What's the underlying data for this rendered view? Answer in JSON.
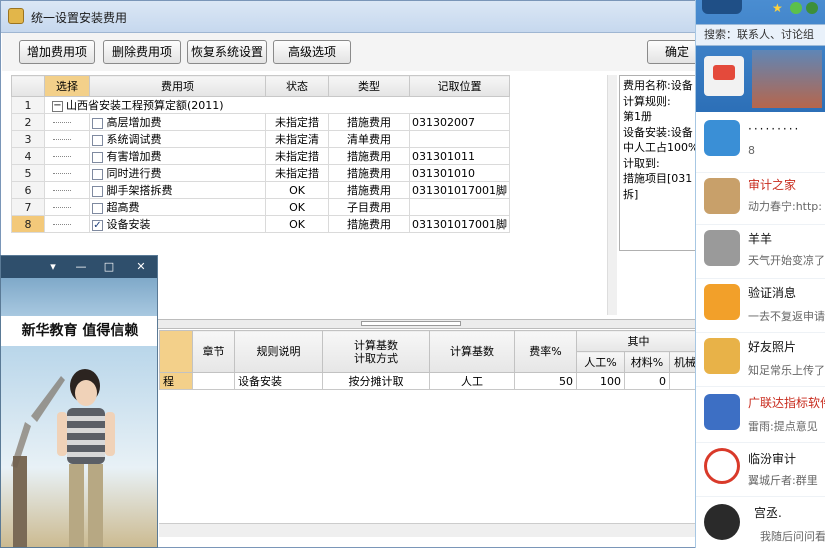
{
  "window": {
    "title": "统一设置安装费用"
  },
  "toolbar": {
    "add_label": "增加费用项",
    "delete_label": "删除费用项",
    "restore_label": "恢复系统设置",
    "advanced_label": "高级选项",
    "confirm_label": "确定"
  },
  "fee_table": {
    "headers": [
      "",
      "选择",
      "费用项",
      "状态",
      "类型",
      "记取位置"
    ],
    "root": {
      "num": "1",
      "name": "山西省安装工程预算定额(2011)"
    },
    "rows": [
      {
        "num": "2",
        "checked": false,
        "name": "高层增加费",
        "status": "未指定措",
        "type": "措施费用",
        "location": "031302007"
      },
      {
        "num": "3",
        "checked": false,
        "name": "系统调试费",
        "status": "未指定清",
        "type": "清单费用",
        "location": ""
      },
      {
        "num": "4",
        "checked": false,
        "name": "有害增加费",
        "status": "未指定措",
        "type": "措施费用",
        "location": "031301011"
      },
      {
        "num": "5",
        "checked": false,
        "name": "同时进行费",
        "status": "未指定措",
        "type": "措施费用",
        "location": "031301010"
      },
      {
        "num": "6",
        "checked": false,
        "name": "脚手架搭拆费",
        "status": "OK",
        "type": "措施费用",
        "location": "031301017001脚"
      },
      {
        "num": "7",
        "checked": false,
        "name": "超高费",
        "status": "OK",
        "type": "子目费用",
        "location": ""
      },
      {
        "num": "8",
        "checked": true,
        "name": "设备安装",
        "status": "OK",
        "type": "措施费用",
        "location": "031301017001脚"
      }
    ]
  },
  "info_panel": {
    "lines": [
      "费用名称:设备",
      "计算规则:",
      "第1册",
      "设备安装:设备",
      "中人工占100%",
      "计取到:",
      "措施项目[031",
      "拆]"
    ]
  },
  "rule_table": {
    "headers": {
      "chapter": "章节",
      "rule": "规则说明",
      "method_1": "计算基数",
      "method_2": "计取方式",
      "base": "计算基数",
      "rate": "费率%",
      "group": "其中",
      "labor": "人工%",
      "material": "材料%",
      "machine": "机械"
    },
    "row": {
      "first": "程",
      "chapter": "",
      "rule": "设备安装",
      "method": "按分摊计取",
      "base": "人工",
      "rate": "50",
      "labor": "100",
      "material": "0",
      "machine": ""
    }
  },
  "ad_popup": {
    "banner": "新华教育  值得信赖",
    "controls": [
      "▾",
      "—",
      "□",
      "✕"
    ]
  },
  "im_panel": {
    "search": "搜索：联系人、讨论组",
    "contacts": [
      {
        "name": "",
        "sub": "8",
        "color": "#3a8fd6"
      },
      {
        "name": "审计之家",
        "sub": "动力春宁:http:",
        "color": "#c8a06a"
      },
      {
        "name": "羊羊",
        "sub": "天气开始变凉了",
        "color": "#9a9a9a"
      },
      {
        "name": "验证消息",
        "sub": "一去不复返申请",
        "color": "#f2a02a"
      },
      {
        "name": "好友照片",
        "sub": "知足常乐上传了",
        "color": "#e8b248"
      },
      {
        "name": "广联达指标软件",
        "sub": "雷雨:提点意见",
        "color": "#3d6fc4"
      },
      {
        "name": "临汾审计",
        "sub": "翼城斤者:群里",
        "color": "#d93a2a"
      },
      {
        "name": "宫丞.",
        "sub": "我随后问问看",
        "color": "#2a2a2a"
      }
    ]
  }
}
